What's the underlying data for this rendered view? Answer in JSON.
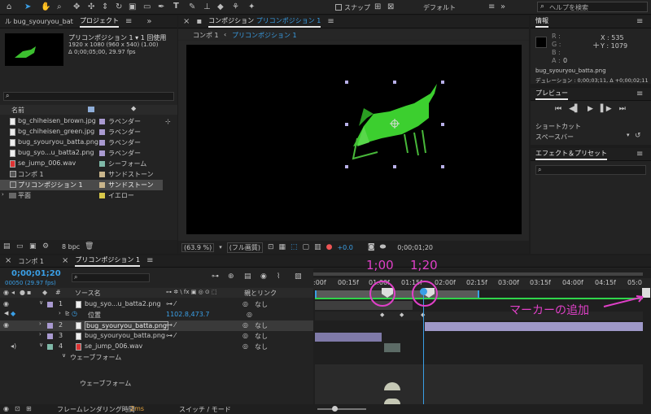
{
  "toolbar": {
    "snap_label": "スナップ",
    "workspace": "デフォルト",
    "search_placeholder": "ヘルプを検索"
  },
  "project": {
    "left_tab": "ル bug_syouryou_batta.png",
    "tab": "プロジェクト",
    "comp_name": "プリコンポジション 1 ▾ 1 回使用",
    "comp_size": "1920 x 1080 (960 x 540) (1.00)",
    "comp_duration": "Δ 0;00;05;00, 29.97 fps",
    "col_name": "名前",
    "items": [
      {
        "name": "bg_chiheisen_brown.jpg",
        "label": "ラベンダー",
        "color": "#a99ad1"
      },
      {
        "name": "bg_chiheisen_green.jpg",
        "label": "ラベンダー",
        "color": "#a99ad1"
      },
      {
        "name": "bug_syouryou_batta.png",
        "label": "ラベンダー",
        "color": "#a99ad1"
      },
      {
        "name": "bug_syo...u_batta2.png",
        "label": "ラベンダー",
        "color": "#a99ad1"
      },
      {
        "name": "se_jump_006.wav",
        "label": "シーフォーム",
        "color": "#7fb9a8"
      },
      {
        "name": "コンポ 1",
        "label": "サンドストーン",
        "color": "#c9b58b"
      },
      {
        "name": "プリコンポジション 1",
        "label": "サンドストーン",
        "color": "#c9b58b"
      },
      {
        "name": "平面",
        "label": "イエロー",
        "color": "#d8c84a"
      }
    ],
    "bpc": "8 bpc"
  },
  "composition": {
    "title": "コンポジション",
    "title_name": "プリコンポジション 1",
    "breadcrumb_1": "コンポ 1",
    "breadcrumb_2": "プリコンポジション 1",
    "zoom": "(63.9 %)",
    "quality": "(フル画質)",
    "exposure": "+0.0",
    "timecode": "0;00;01;20"
  },
  "info": {
    "tab": "情報",
    "r": "R :",
    "g": "G :",
    "b": "B :",
    "a": "A :",
    "a_val": "0",
    "x": "X : 535",
    "y": "Y : 1079",
    "file": "bug_syouryou_batta.png",
    "duration": "デュレーション : 0;00;03;11, Δ +0;00;02;11"
  },
  "preview": {
    "tab": "プレビュー",
    "shortcut_label": "ショートカット",
    "shortcut_value": "スペースバー"
  },
  "effects": {
    "tab": "エフェクト＆プリセット"
  },
  "timeline": {
    "tab1": "コンポ 1",
    "tab2": "プリコンポジション 1",
    "timecode": "0;00;01;20",
    "fps": "00050 (29.97 fps)",
    "col_source": "ソース名",
    "col_parent": "親とリンク",
    "ruler": [
      ":00f",
      "00:15f",
      "01:00f",
      "01:15f",
      "02:00f",
      "02:15f",
      "03:00f",
      "03:15f",
      "04:00f",
      "04:15f",
      "05:0"
    ],
    "layers": [
      {
        "num": "1",
        "name": "bug_syo...u_batta2.png",
        "parent": "なし",
        "color": "#a99ad1"
      },
      {
        "num": "2",
        "name": "bug_syouryou_batta.png",
        "parent": "なし",
        "color": "#a99ad1"
      },
      {
        "num": "3",
        "name": "bug_syouryou_batta.png",
        "parent": "なし",
        "color": "#a99ad1"
      },
      {
        "num": "4",
        "name": "se_jump_006.wav",
        "parent": "なし",
        "color": "#7fb9a8"
      }
    ],
    "position_label": "位置",
    "position_value": "1102.8,473.7",
    "waveform_group": "ウェーブフォーム",
    "waveform": "ウェーブフォーム",
    "footer_render": "フレームレンダリング時間",
    "footer_ms": "2ms",
    "footer_switch": "スイッチ / モード"
  },
  "annotations": {
    "mark1": "1;00",
    "mark2": "1;20",
    "add_marker": "マーカーの追加"
  }
}
